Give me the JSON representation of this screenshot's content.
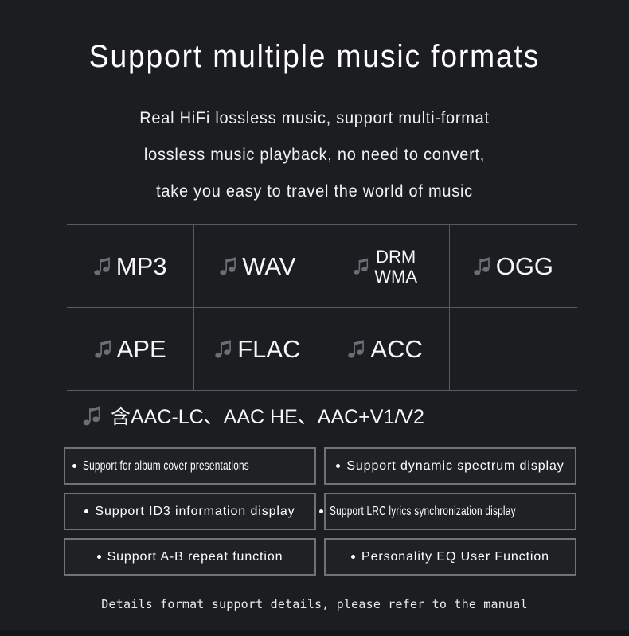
{
  "heading": {
    "title": "Support multiple music formats",
    "subtitle_lines": [
      "Real HiFi lossless music, support multi-format",
      "lossless music playback, no need to convert,",
      "take you easy to travel the world of music"
    ]
  },
  "format_grid": {
    "note_icon": "music-note-icon",
    "rows": [
      [
        {
          "label": "MP3",
          "lines": null
        },
        {
          "label": "WAV",
          "lines": null
        },
        {
          "label": null,
          "lines": [
            "DRM",
            "WMA"
          ]
        },
        {
          "label": "OGG",
          "lines": null
        }
      ],
      [
        {
          "label": "APE",
          "lines": null
        },
        {
          "label": "FLAC",
          "lines": null
        },
        {
          "label": "ACC",
          "lines": null
        },
        {
          "label": "",
          "lines": null
        }
      ]
    ]
  },
  "aac_note": {
    "icon": "music-note-icon",
    "text": "含AAC-LC、AAC HE、AAC+V1/V2"
  },
  "features": {
    "rows": [
      {
        "left": "Support for album cover presentations",
        "right": "Support dynamic spectrum display"
      },
      {
        "left": "Support ID3 information display",
        "right": "Support LRC lyrics synchronization display"
      },
      {
        "left": "Support A-B repeat function",
        "right": "Personality EQ User Function"
      }
    ]
  },
  "footer": {
    "text": "Details format support details, please refer to the manual"
  },
  "colors": {
    "background": "#1b1d20",
    "grid_line": "#555b60",
    "box_border": "#6e7378",
    "note_icon": "#6b6f74",
    "text_primary": "#ffffff"
  }
}
